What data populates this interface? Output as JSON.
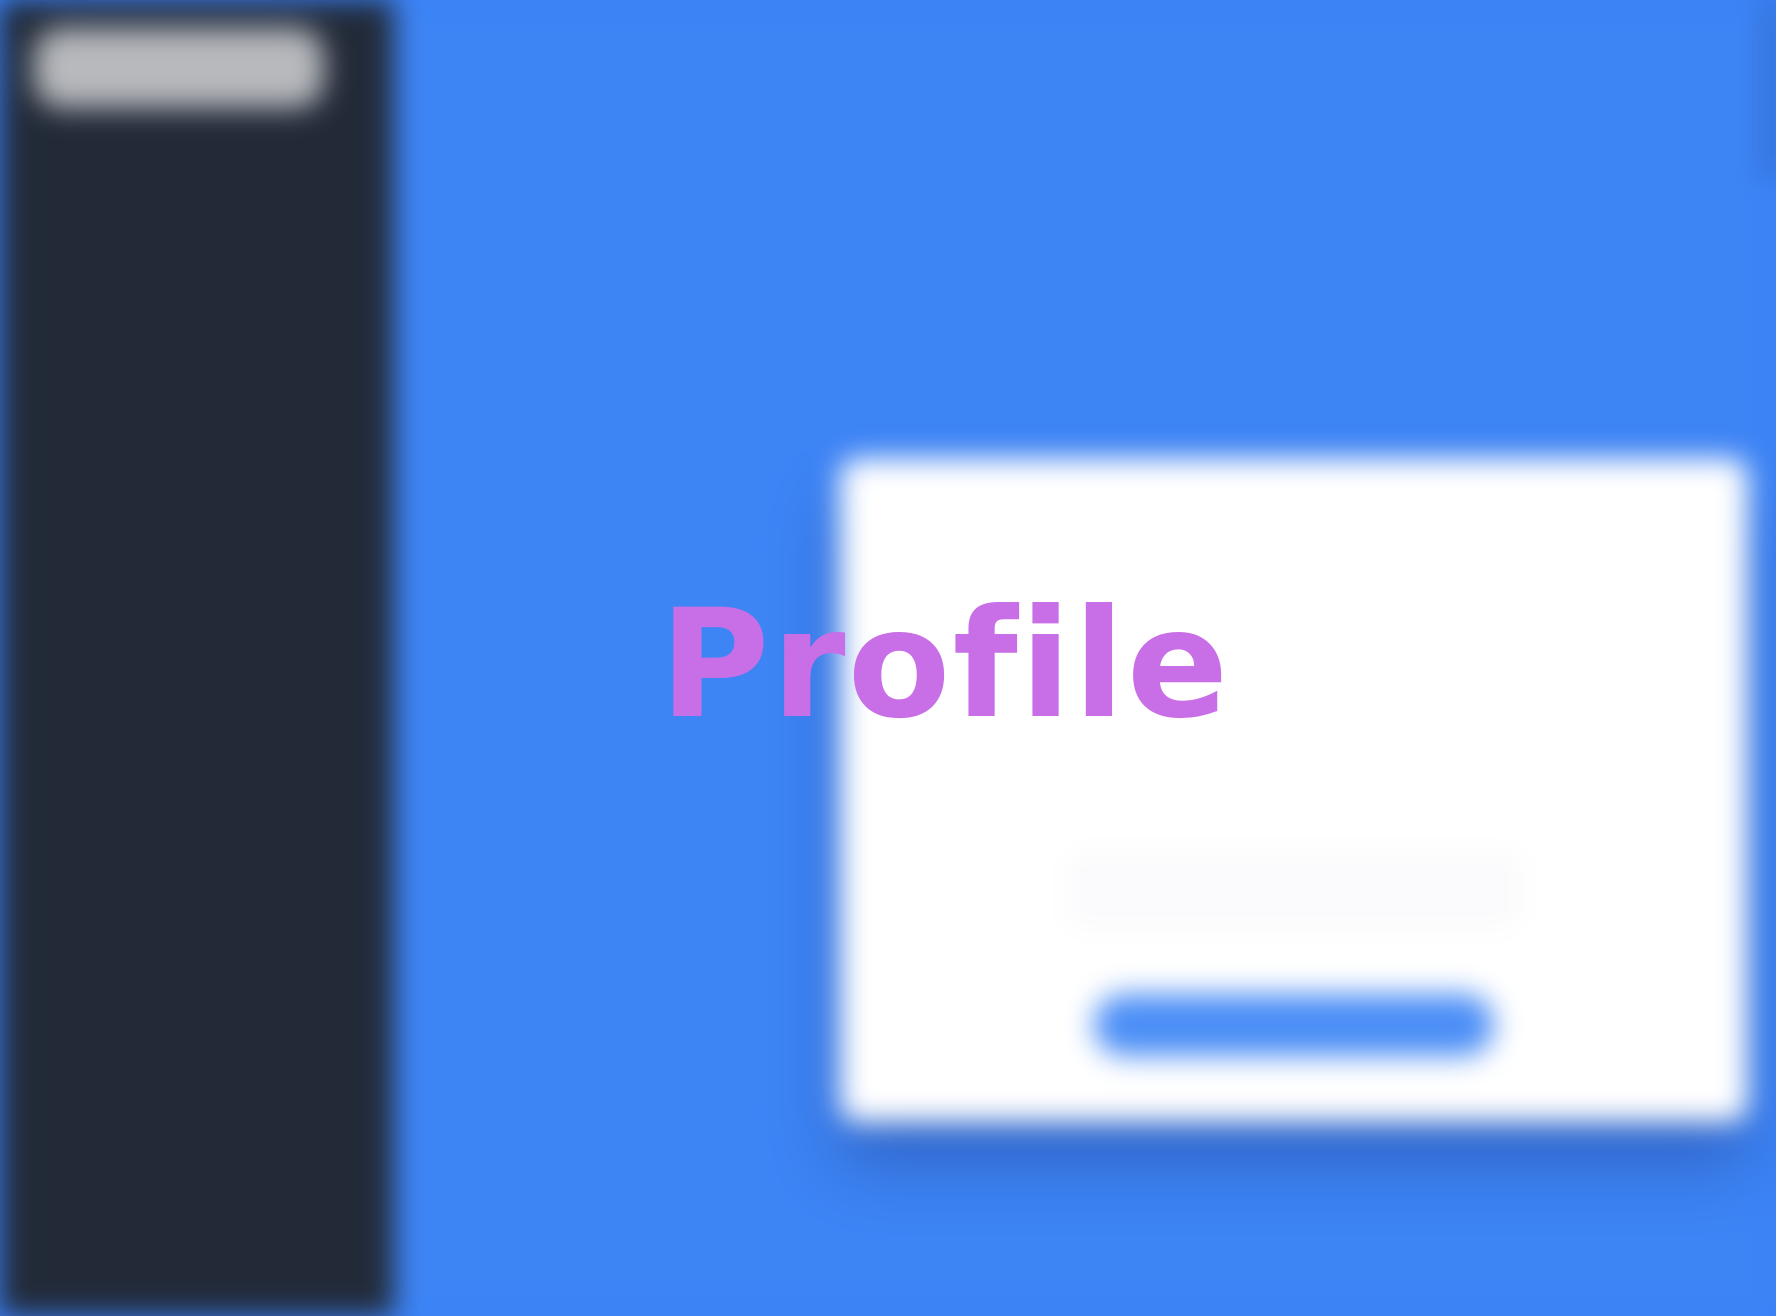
{
  "overlay": {
    "title": "Profile"
  },
  "colors": {
    "sidebar_bg": "#222a38",
    "main_bg": "#3d84f5",
    "card_bg": "#ffffff",
    "accent": "#4b8ef6",
    "overlay_text": "#c86ee6"
  }
}
